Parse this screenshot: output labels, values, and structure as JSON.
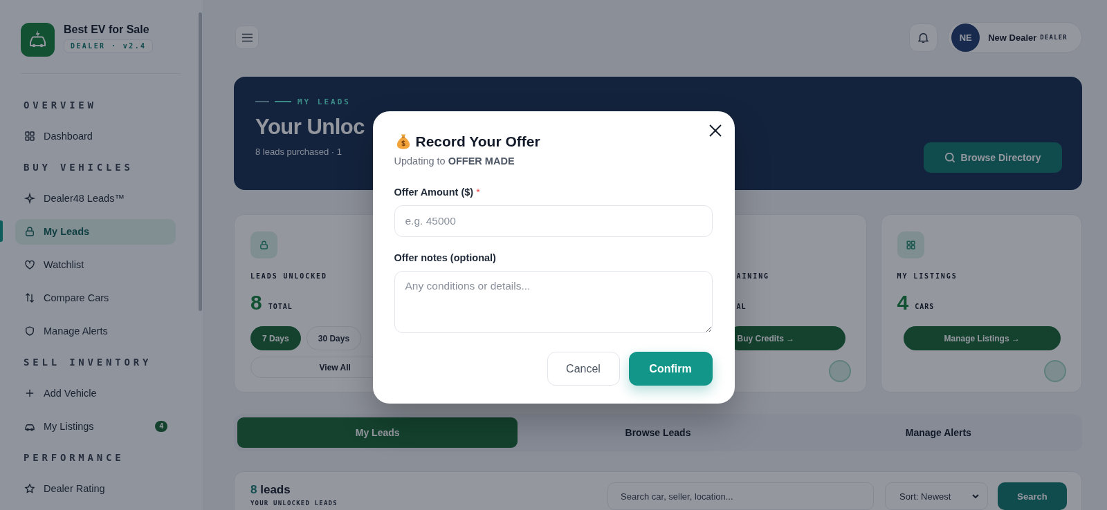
{
  "sidebar": {
    "brand": {
      "name": "Best EV for Sale",
      "badge": "DEALER · v2.4"
    },
    "sections": [
      {
        "title": "OVERVIEW",
        "items": [
          {
            "label": "Dashboard",
            "selected": false
          }
        ]
      },
      {
        "title": "BUY VEHICLES",
        "items": [
          {
            "label": "Dealer48 Leads™",
            "selected": false
          },
          {
            "label": "My Leads",
            "selected": true
          },
          {
            "label": "Watchlist",
            "selected": false
          },
          {
            "label": "Compare Cars",
            "selected": false
          },
          {
            "label": "Manage Alerts",
            "selected": false
          }
        ]
      },
      {
        "title": "SELL INVENTORY",
        "items": [
          {
            "label": "Add Vehicle",
            "selected": false
          },
          {
            "label": "My Listings",
            "selected": false,
            "badge": "4"
          }
        ]
      },
      {
        "title": "PERFORMANCE",
        "items": [
          {
            "label": "Dealer Rating",
            "selected": false
          }
        ]
      }
    ]
  },
  "header": {
    "user": {
      "initials": "NE",
      "name": "New Dealer",
      "role": "DEALER"
    }
  },
  "banner": {
    "eyebrow": "MY LEADS",
    "title": "Your Unloc",
    "subtitle": "8 leads purchased · 1",
    "button": "Browse Directory"
  },
  "stats": [
    {
      "kind": "filters",
      "label": "LEADS UNLOCKED",
      "value": "8",
      "unit": "TOTAL",
      "filters": [
        {
          "label": "7 Days",
          "selected": true
        },
        {
          "label": "30 Days",
          "selected": false
        }
      ],
      "link": "View All"
    },
    {
      "kind": "partial",
      "label": "AINING",
      "unit": "AL",
      "button": "Buy Credits →"
    },
    {
      "kind": "action",
      "label": "MY LISTINGS",
      "value": "4",
      "unit": "CARS",
      "button": "Manage Listings →"
    }
  ],
  "tabs": [
    {
      "label": "My Leads",
      "selected": true
    },
    {
      "label": "Browse Leads",
      "selected": false
    },
    {
      "label": "Manage Alerts",
      "selected": false
    }
  ],
  "leads_panel": {
    "count": "8",
    "label": "leads",
    "subtitle": "YOUR UNLOCKED LEADS",
    "search": {
      "placeholder": "Search car, seller, location..."
    },
    "sort": "Sort: Newest",
    "button": "Search"
  },
  "modal": {
    "title": "Record Your Offer",
    "subtitle": "Updating to **OFFER MADE**",
    "fields": [
      {
        "kind": "input",
        "label": "Offer Amount ($)",
        "required_mark": "*",
        "placeholder": "e.g. 45000"
      },
      {
        "kind": "textarea",
        "label": "Offer notes (optional)",
        "placeholder": "Any conditions or details..."
      }
    ],
    "buttons": [
      {
        "kind": "secondary",
        "label": "Cancel"
      },
      {
        "kind": "primary",
        "label": "Confirm"
      }
    ]
  }
}
